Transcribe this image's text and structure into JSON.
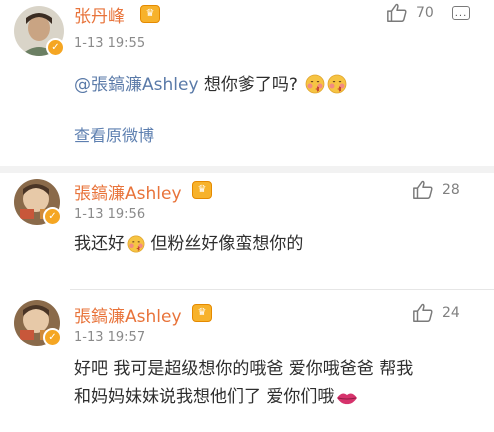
{
  "post": {
    "author": "张丹峰",
    "time": "1-13 19:55",
    "likes": "70",
    "mention": "@張鎬濂Ashley",
    "text": " 想你爹了吗?",
    "view_original": "查看原微博"
  },
  "replies": [
    {
      "author": "張鎬濂Ashley",
      "time": "1-13 19:56",
      "likes": "28",
      "text_part1": "我还好",
      "text_part2": " 但粉丝好像蛮想你的"
    },
    {
      "author": "張鎬濂Ashley",
      "time": "1-13 19:57",
      "likes": "24",
      "line1": "好吧 我可是超级想你的哦爸 爱你哦爸爸 帮我",
      "line2": "和妈妈妹妹说我想他们了 爱你们哦"
    }
  ],
  "colors": {
    "name": "#e8733a",
    "mention": "#5a7aa8",
    "link": "#5d7fb0",
    "verify_badge": "#f5a623",
    "vip_badge": "#f7b22b"
  },
  "icons": {
    "like": "thumbs-up-icon",
    "verified": "verified-badge-icon",
    "vip": "vip-badge-icon",
    "more": "more-icon",
    "kiss_emoji": "kissing-face-emoji",
    "lips_emoji": "lips-emoji"
  }
}
